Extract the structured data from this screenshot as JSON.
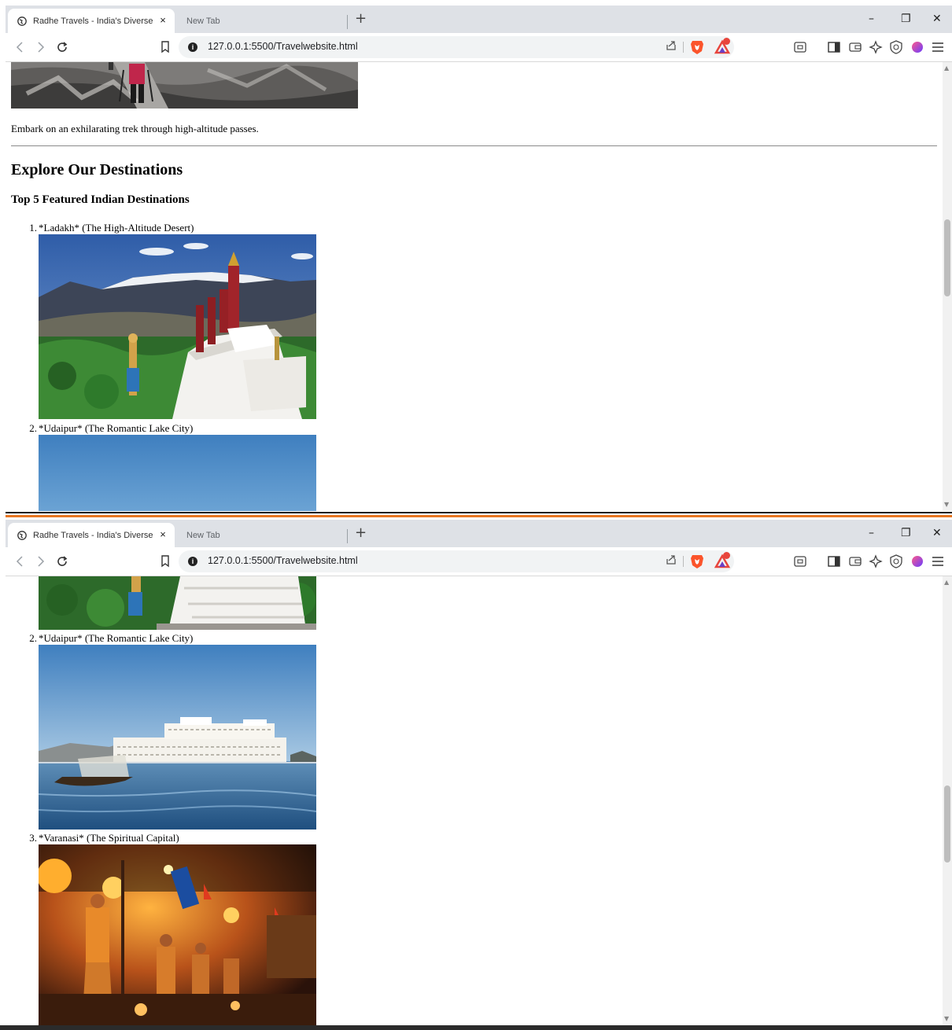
{
  "browser": {
    "active_tab_title": "Radhe Travels - India's Diverse Je",
    "inactive_tab_title": "New Tab",
    "new_tab_glyph": "+",
    "close_glyph": "×",
    "url": "127.0.0.1:5500/Travelwebsite.html",
    "info_glyph": "i",
    "window_controls": [
      "–",
      "❐",
      "✕"
    ],
    "icons": [
      "back-icon",
      "forward-icon",
      "reload-icon",
      "bookmark-icon",
      "site-info-icon",
      "share-icon",
      "brave-shield-icon",
      "brave-rewards-icon",
      "reader-mode-icon",
      "sidebar-icon",
      "wallet-icon",
      "leo-ai-icon",
      "vpn-icon",
      "profile-icon",
      "menu-icon"
    ]
  },
  "page": {
    "trek_caption": "Embark on an exhilarating trek through high-altitude passes.",
    "section_heading": "Explore Our Destinations",
    "sub_heading": "Top 5 Featured Indian Destinations",
    "destinations": [
      {
        "number": "1.",
        "label": "*Ladakh* (The High-Altitude Desert)",
        "image": "ladakh-stupa-photo"
      },
      {
        "number": "2.",
        "label": "*Udaipur* (The Romantic Lake City)",
        "image": "udaipur-lake-palace-photo"
      },
      {
        "number": "3.",
        "label": "*Varanasi* (The Spiritual Capital)",
        "image": "varanasi-ganga-aarti-photo"
      }
    ]
  },
  "colors": {
    "tabbar": "#dee1e6",
    "omnibox": "#f1f3f4",
    "brave_orange": "#fb542b",
    "divider_orange": "#e87722"
  }
}
